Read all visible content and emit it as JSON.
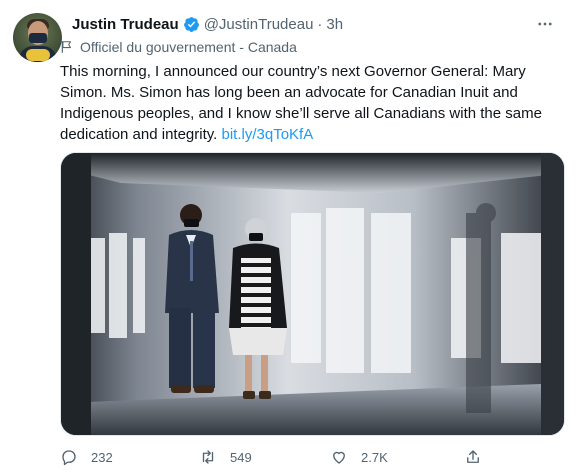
{
  "tweet": {
    "author_name": "Justin Trudeau",
    "handle": "@JustinTrudeau",
    "separator": "·",
    "time": "3h",
    "label": "Officiel du gouvernement - Canada",
    "text": "This morning, I announced our country’s next Governor General: Mary Simon. Ms. Simon has long been an advocate for Canadian Inuit and Indigenous peoples, and I know she’ll serve all Canadians with the same dedication and integrity.",
    "link": "bit.ly/3qToKfA"
  },
  "actions": {
    "reply_count": "232",
    "retweet_count": "549",
    "like_count": "2.7K"
  },
  "colors": {
    "accent": "#1d9bf0",
    "secondary_text": "#536471",
    "primary_text": "#0f1419"
  },
  "icons": [
    "verified-badge-icon",
    "more-options-icon",
    "government-flag-icon",
    "reply-icon",
    "retweet-icon",
    "like-icon",
    "share-icon"
  ]
}
